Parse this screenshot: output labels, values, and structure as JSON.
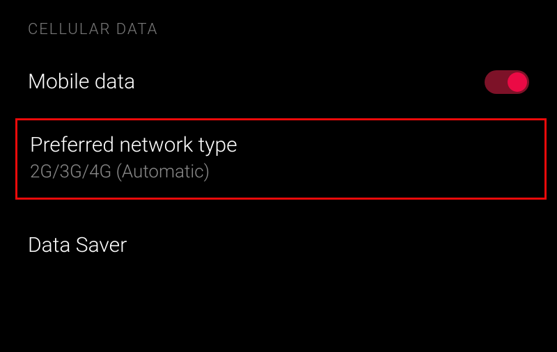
{
  "section_header": "CELLULAR DATA",
  "mobile_data": {
    "label": "Mobile data",
    "toggle_on": true
  },
  "preferred_network": {
    "title": "Preferred network type",
    "subtitle": "2G/3G/4G (Automatic)"
  },
  "data_saver": {
    "label": "Data Saver"
  }
}
